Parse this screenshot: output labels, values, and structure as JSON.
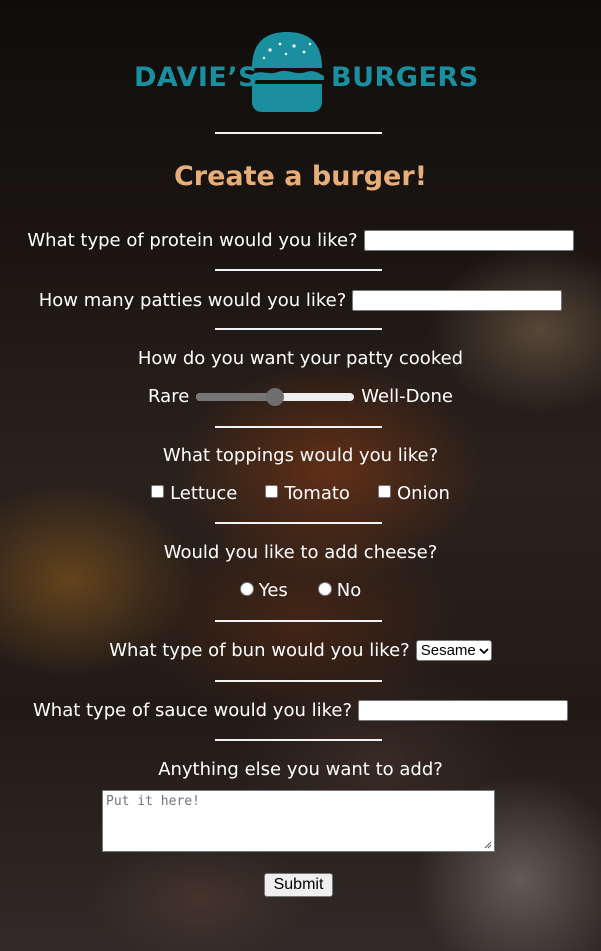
{
  "logo": {
    "left_text": "DAVIE’S",
    "right_text": "BURGERS",
    "brand_color": "#1a8fa0"
  },
  "title": "Create a burger!",
  "protein": {
    "label": "What type of protein would you like?",
    "value": "",
    "placeholder": ""
  },
  "patties": {
    "label": "How many patties would you like?",
    "value": "",
    "placeholder": ""
  },
  "cooked": {
    "label": "How do you want your patty cooked",
    "min_label": "Rare",
    "max_label": "Well-Done",
    "level_fraction": 0.5
  },
  "toppings": {
    "label": "What toppings would you like?",
    "options": [
      {
        "label": "Lettuce",
        "checked": false
      },
      {
        "label": "Tomato",
        "checked": false
      },
      {
        "label": "Onion",
        "checked": false
      }
    ]
  },
  "cheese": {
    "label": "Would you like to add cheese?",
    "options": [
      {
        "label": "Yes",
        "selected": false
      },
      {
        "label": "No",
        "selected": false
      }
    ]
  },
  "bun": {
    "label": "What type of bun would you like?",
    "selected": "Sesame"
  },
  "sauce": {
    "label": "What type of sauce would you like?",
    "value": "",
    "placeholder": ""
  },
  "extra": {
    "label": "Anything else you want to add?",
    "placeholder": "Put it here!"
  },
  "submit_label": "Submit",
  "colors": {
    "title": "#e8ae7a",
    "text": "#ffffff",
    "divider": "#f2f2f2"
  }
}
